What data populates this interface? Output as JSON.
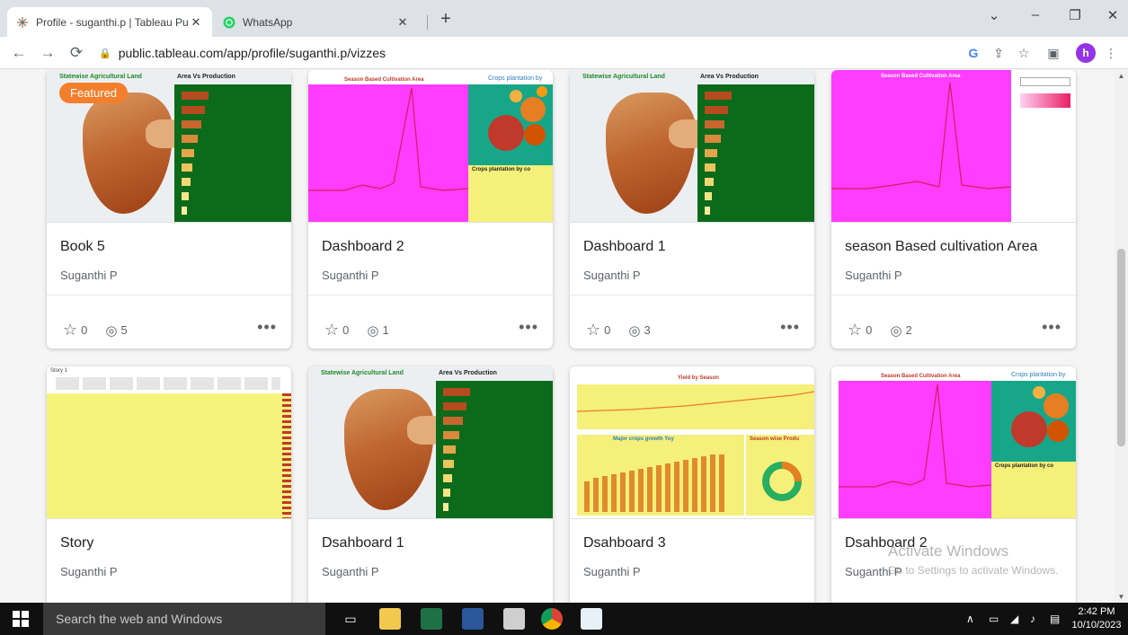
{
  "browser": {
    "tabs": [
      {
        "title": "Profile - suganthi.p | Tableau Pul",
        "active": true
      },
      {
        "title": "WhatsApp",
        "active": false
      }
    ],
    "new_tab_label": "+",
    "url": "public.tableau.com/app/profile/suganthi.p/vizzes",
    "profile_initial": "h",
    "window_controls": {
      "dropdown": "⌄",
      "minimize": "–",
      "restore": "❐",
      "close": "✕"
    }
  },
  "cards": [
    {
      "title": "Book 5",
      "author": "Suganthi P",
      "favorites": "0",
      "views": "5",
      "badge": "Featured"
    },
    {
      "title": "Dashboard 2",
      "author": "Suganthi P",
      "favorites": "0",
      "views": "1"
    },
    {
      "title": "Dashboard 1",
      "author": "Suganthi P",
      "favorites": "0",
      "views": "3"
    },
    {
      "title": "season Based cultivation Area",
      "author": "Suganthi P",
      "favorites": "0",
      "views": "2"
    },
    {
      "title": "Story",
      "author": "Suganthi P"
    },
    {
      "title": "Dsahboard 1",
      "author": "Suganthi P"
    },
    {
      "title": "Dsahboard 3",
      "author": "Suganthi P"
    },
    {
      "title": "Dsahboard 2",
      "author": "Suganthi P"
    }
  ],
  "thumb_text": {
    "statewise": "Statewise Agricultural Land",
    "area_vs_prod": "Area Vs Production",
    "season_based": "Season Based Cultivation Area",
    "crops_plantation": "Crops plantation by",
    "crops_plantation_2": "Crops plantation by co",
    "story": "Story 1",
    "yield_season": "Yield by Season",
    "major_crops": "Major crops growth Yoy",
    "season_wise": "Season wise Produ"
  },
  "more_label": "•••",
  "watermark": {
    "line1": "Activate Windows",
    "line2": "Go to Settings to activate Windows."
  },
  "taskbar": {
    "search_placeholder": "Search the web and Windows",
    "time": "2:42 PM",
    "date": "10/10/2023"
  }
}
